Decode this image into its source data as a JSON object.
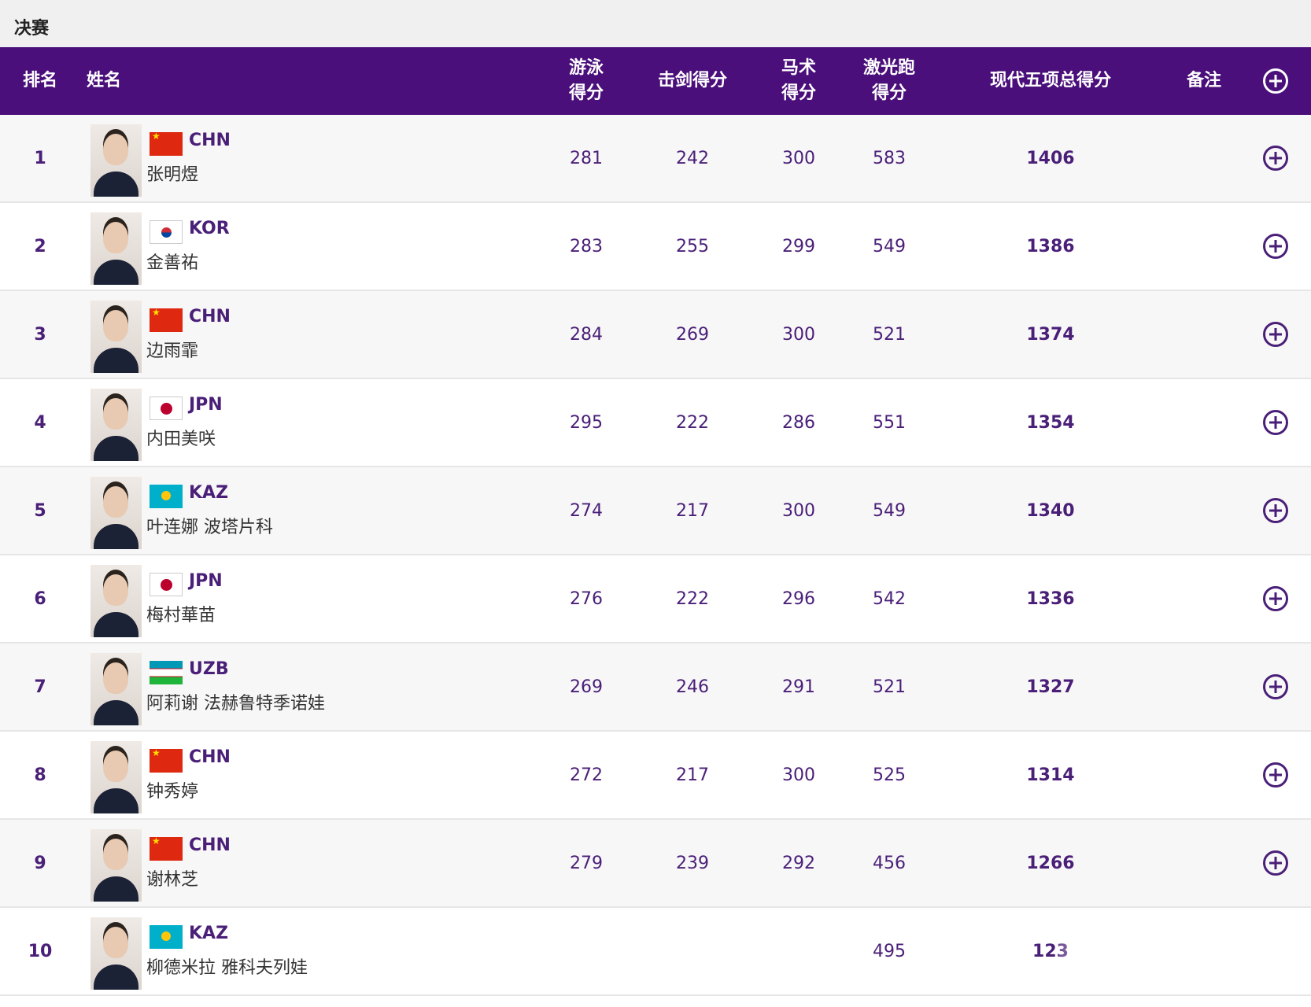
{
  "section": {
    "title": "决赛"
  },
  "header": {
    "rank": "排名",
    "name": "姓名",
    "swim": "游泳\n得分",
    "fence": "击剑得分",
    "horse": "马术\n得分",
    "laser": "激光跑\n得分",
    "total": "现代五项总得分",
    "note": "备注"
  },
  "rows": [
    {
      "rank": "1",
      "country": "CHN",
      "name": "张明煜",
      "swim": "281",
      "fence": "242",
      "horse": "300",
      "laser": "583",
      "total": "1406"
    },
    {
      "rank": "2",
      "country": "KOR",
      "name": "金善祐",
      "swim": "283",
      "fence": "255",
      "horse": "299",
      "laser": "549",
      "total": "1386"
    },
    {
      "rank": "3",
      "country": "CHN",
      "name": "边雨霏",
      "swim": "284",
      "fence": "269",
      "horse": "300",
      "laser": "521",
      "total": "1374"
    },
    {
      "rank": "4",
      "country": "JPN",
      "name": "内田美咲",
      "swim": "295",
      "fence": "222",
      "horse": "286",
      "laser": "551",
      "total": "1354"
    },
    {
      "rank": "5",
      "country": "KAZ",
      "name": "叶连娜 波塔片科",
      "swim": "274",
      "fence": "217",
      "horse": "300",
      "laser": "549",
      "total": "1340"
    },
    {
      "rank": "6",
      "country": "JPN",
      "name": "梅村華苗",
      "swim": "276",
      "fence": "222",
      "horse": "296",
      "laser": "542",
      "total": "1336"
    },
    {
      "rank": "7",
      "country": "UZB",
      "name": "阿莉谢 法赫鲁特季诺娃",
      "swim": "269",
      "fence": "246",
      "horse": "291",
      "laser": "521",
      "total": "1327"
    },
    {
      "rank": "8",
      "country": "CHN",
      "name": "钟秀婷",
      "swim": "272",
      "fence": "217",
      "horse": "300",
      "laser": "525",
      "total": "1314"
    },
    {
      "rank": "9",
      "country": "CHN",
      "name": "谢林芝",
      "swim": "279",
      "fence": "239",
      "horse": "292",
      "laser": "456",
      "total": "1266"
    },
    {
      "rank": "10",
      "country": "KAZ",
      "name": "柳德米拉 雅科夫列娃",
      "swim": "",
      "fence": "",
      "horse": "",
      "laser": "495",
      "total": "123"
    }
  ],
  "colors": {
    "header_bg": "#4a0f7a",
    "accent_text": "#4a1f78"
  },
  "icons": {
    "expand": "plus-circle-icon"
  }
}
